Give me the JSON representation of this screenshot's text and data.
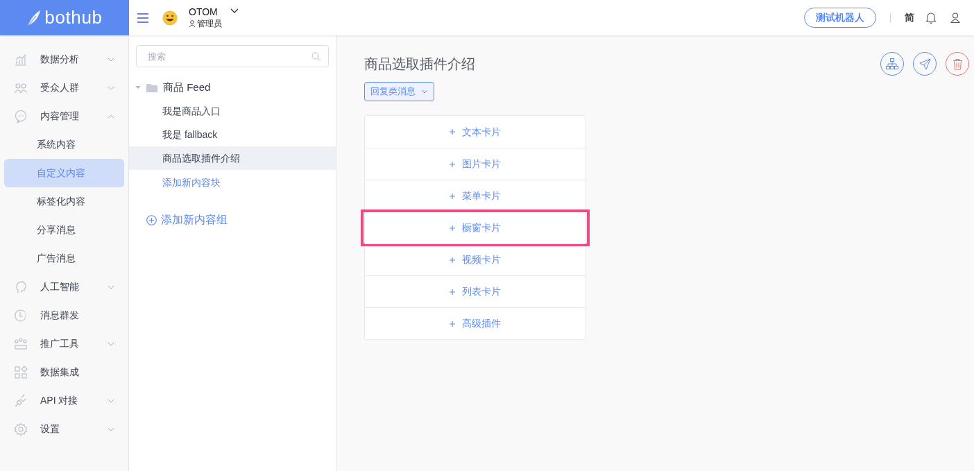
{
  "header": {
    "logo": "bothub",
    "account": {
      "name": "OTOM",
      "role": "管理员"
    },
    "test_button": "测试机器人",
    "language": "简"
  },
  "sidebar": {
    "items": [
      {
        "label": "数据分析",
        "kind": "group",
        "expanded": false
      },
      {
        "label": "受众人群",
        "kind": "group",
        "expanded": false
      },
      {
        "label": "内容管理",
        "kind": "group",
        "expanded": true,
        "children": [
          {
            "label": "系统内容",
            "selected": false
          },
          {
            "label": "自定义内容",
            "selected": true
          },
          {
            "label": "标签化内容",
            "selected": false
          },
          {
            "label": "分享消息",
            "selected": false
          },
          {
            "label": "广告消息",
            "selected": false
          }
        ]
      },
      {
        "label": "人工智能",
        "kind": "group",
        "expanded": false
      },
      {
        "label": "消息群发",
        "kind": "link"
      },
      {
        "label": "推广工具",
        "kind": "group",
        "expanded": false
      },
      {
        "label": "数据集成",
        "kind": "link"
      },
      {
        "label": "API 对接",
        "kind": "group",
        "expanded": false
      },
      {
        "label": "设置",
        "kind": "group",
        "expanded": false
      }
    ]
  },
  "content_tree": {
    "search": {
      "placeholder": "搜索"
    },
    "folders": [
      {
        "label": "商品 Feed",
        "expanded": true,
        "children": [
          {
            "label": "我是商品入口",
            "selected": false
          },
          {
            "label": "我是 fallback",
            "selected": false
          },
          {
            "label": "商品选取插件介绍",
            "selected": true
          }
        ],
        "add_block": "添加新内容块"
      }
    ],
    "add_group": "添加新内容组"
  },
  "editor": {
    "title": "商品选取插件介绍",
    "type_dropdown": "回复类消息",
    "cards": [
      {
        "label": "文本卡片",
        "highlighted": false
      },
      {
        "label": "图片卡片",
        "highlighted": false
      },
      {
        "label": "菜单卡片",
        "highlighted": false
      },
      {
        "label": "橱窗卡片",
        "highlighted": true
      },
      {
        "label": "视频卡片",
        "highlighted": false
      },
      {
        "label": "列表卡片",
        "highlighted": false
      },
      {
        "label": "高级插件",
        "highlighted": false
      }
    ]
  }
}
